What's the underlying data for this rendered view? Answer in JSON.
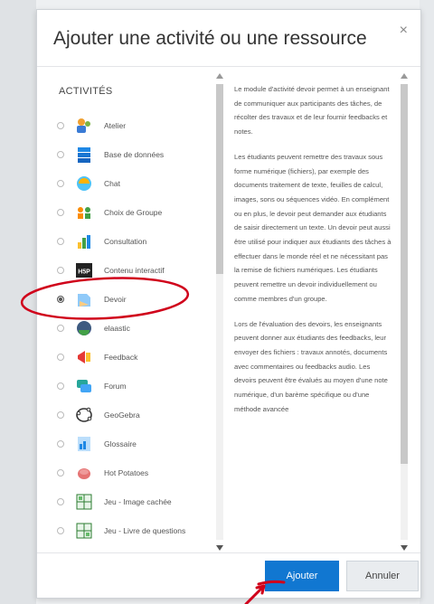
{
  "modal": {
    "title": "Ajouter une activité ou une ressource",
    "close_label": "×"
  },
  "activities": {
    "heading": "ACTIVITÉS",
    "items": [
      {
        "label": "Atelier",
        "icon": "workshop-icon",
        "selected": false
      },
      {
        "label": "Base de données",
        "icon": "database-icon",
        "selected": false
      },
      {
        "label": "Chat",
        "icon": "chat-icon",
        "selected": false
      },
      {
        "label": "Choix de Groupe",
        "icon": "group-choice-icon",
        "selected": false
      },
      {
        "label": "Consultation",
        "icon": "chart-icon",
        "selected": false
      },
      {
        "label": "Contenu interactif",
        "icon": "h5p-icon",
        "selected": false
      },
      {
        "label": "Devoir",
        "icon": "assignment-icon",
        "selected": true
      },
      {
        "label": "elaastic",
        "icon": "elaastic-icon",
        "selected": false
      },
      {
        "label": "Feedback",
        "icon": "feedback-icon",
        "selected": false
      },
      {
        "label": "Forum",
        "icon": "forum-icon",
        "selected": false
      },
      {
        "label": "GeoGebra",
        "icon": "geogebra-icon",
        "selected": false
      },
      {
        "label": "Glossaire",
        "icon": "glossary-icon",
        "selected": false
      },
      {
        "label": "Hot Potatoes",
        "icon": "hot-potatoes-icon",
        "selected": false
      },
      {
        "label": "Jeu - Image cachée",
        "icon": "hidden-picture-icon",
        "selected": false
      },
      {
        "label": "Jeu - Livre de questions",
        "icon": "book-questions-icon",
        "selected": false
      }
    ]
  },
  "description": {
    "paragraphs": [
      "Le module d'activité devoir permet à un enseignant de communiquer aux participants des tâches, de récolter des travaux et de leur fournir feedbacks et notes.",
      "Les étudiants peuvent remettre des travaux sous forme numérique (fichiers), par exemple des documents traitement de texte, feuilles de calcul, images, sons ou séquences vidéo. En complément ou en plus, le devoir peut demander aux étudiants de saisir directement un texte. Un devoir peut aussi être utilisé pour indiquer aux étudiants des tâches à effectuer dans le monde réel et ne nécessitant pas la remise de fichiers numériques. Les étudiants peuvent remettre un devoir individuellement ou comme membres d'un groupe.",
      "Lors de l'évaluation des devoirs, les enseignants peuvent donner aux étudiants des feedbacks, leur envoyer des fichiers : travaux annotés, documents avec commentaires ou feedbacks audio. Les devoirs peuvent être évalués au moyen d'une note numérique, d'un barème spécifique ou d'une méthode avancée"
    ]
  },
  "footer": {
    "add_label": "Ajouter",
    "cancel_label": "Annuler"
  },
  "colors": {
    "primary": "#1177d1",
    "annotation": "#d0021b"
  }
}
